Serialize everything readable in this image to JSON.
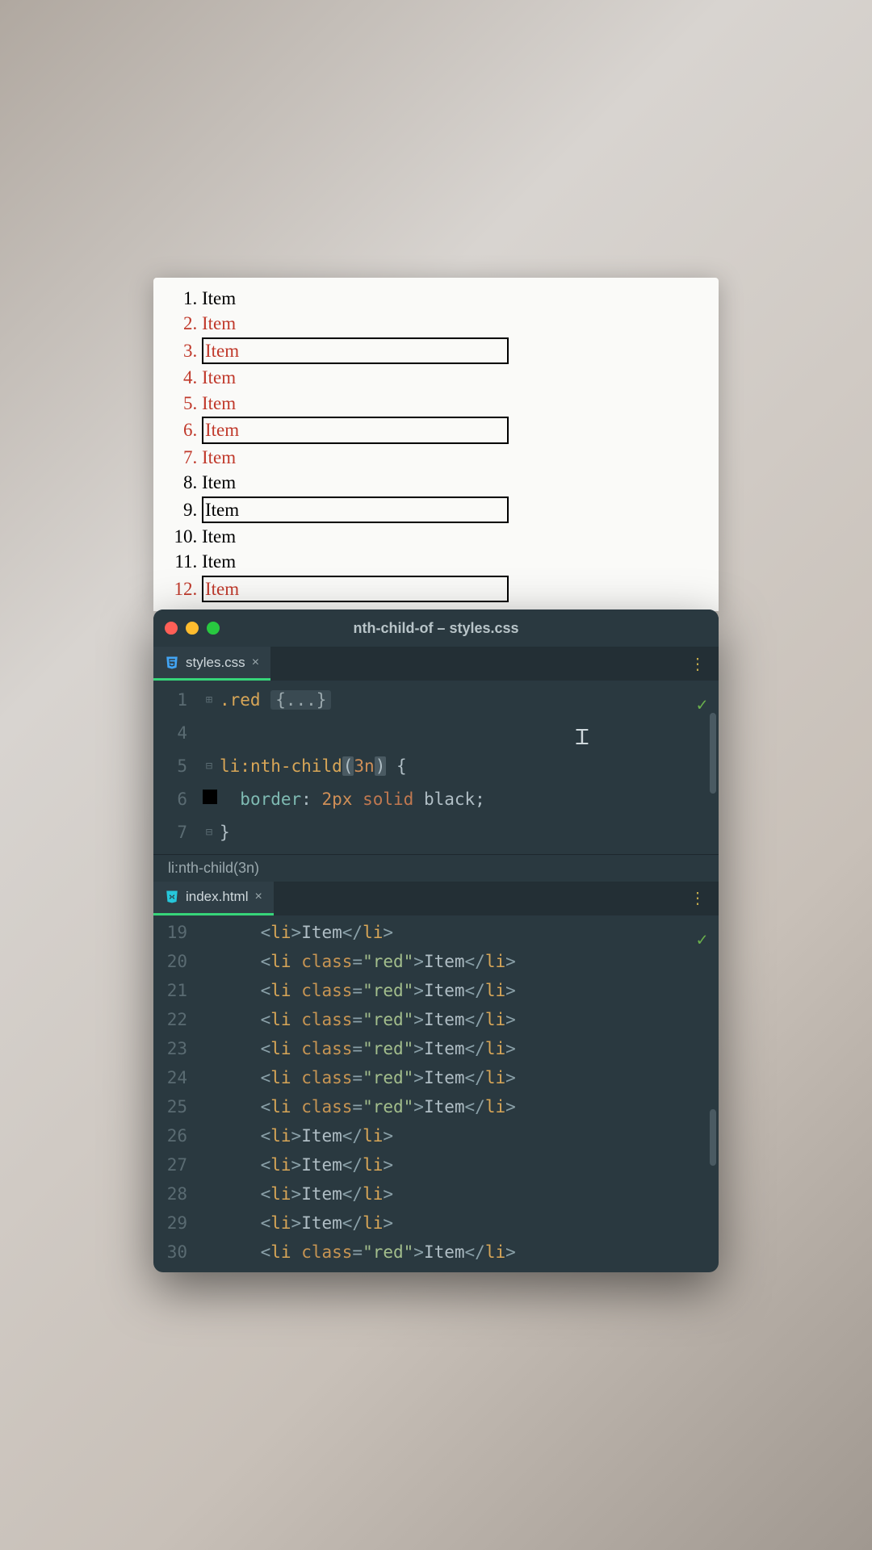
{
  "preview": {
    "items": [
      {
        "text": "Item",
        "red": false,
        "boxed": false
      },
      {
        "text": "Item",
        "red": true,
        "boxed": false
      },
      {
        "text": "Item",
        "red": true,
        "boxed": true
      },
      {
        "text": "Item",
        "red": true,
        "boxed": false
      },
      {
        "text": "Item",
        "red": true,
        "boxed": false
      },
      {
        "text": "Item",
        "red": true,
        "boxed": true
      },
      {
        "text": "Item",
        "red": true,
        "boxed": false
      },
      {
        "text": "Item",
        "red": false,
        "boxed": false
      },
      {
        "text": "Item",
        "red": false,
        "boxed": true
      },
      {
        "text": "Item",
        "red": false,
        "boxed": false
      },
      {
        "text": "Item",
        "red": false,
        "boxed": false
      },
      {
        "text": "Item",
        "red": true,
        "boxed": true
      }
    ]
  },
  "window": {
    "title": "nth-child-of – styles.css"
  },
  "css_tab": {
    "filename": "styles.css"
  },
  "html_tab": {
    "filename": "index.html"
  },
  "breadcrumb": "li:nth-child(3n)",
  "css_code": {
    "line1_num": "1",
    "line1_sel": ".red",
    "line1_collapsed": "{...}",
    "line4_num": "4",
    "line5_num": "5",
    "line5_a": "li",
    "line5_b": ":nth-child",
    "line5_p1": "(",
    "line5_arg": "3n",
    "line5_p2": ")",
    "line5_brace": "{",
    "line6_num": "6",
    "line6_prop": "border",
    "line6_colon": ":",
    "line6_val1": "2px",
    "line6_val2": "solid",
    "line6_val3": "black",
    "line6_semi": ";",
    "line7_num": "7",
    "line7_brace": "}"
  },
  "html_code": {
    "rows": [
      {
        "n": "19",
        "red": false
      },
      {
        "n": "20",
        "red": true
      },
      {
        "n": "21",
        "red": true
      },
      {
        "n": "22",
        "red": true
      },
      {
        "n": "23",
        "red": true
      },
      {
        "n": "24",
        "red": true
      },
      {
        "n": "25",
        "red": true
      },
      {
        "n": "26",
        "red": false
      },
      {
        "n": "27",
        "red": false
      },
      {
        "n": "28",
        "red": false
      },
      {
        "n": "29",
        "red": false
      },
      {
        "n": "30",
        "red": true
      }
    ],
    "tag": "li",
    "attr": "class",
    "val": "\"red\"",
    "text": "Item"
  }
}
